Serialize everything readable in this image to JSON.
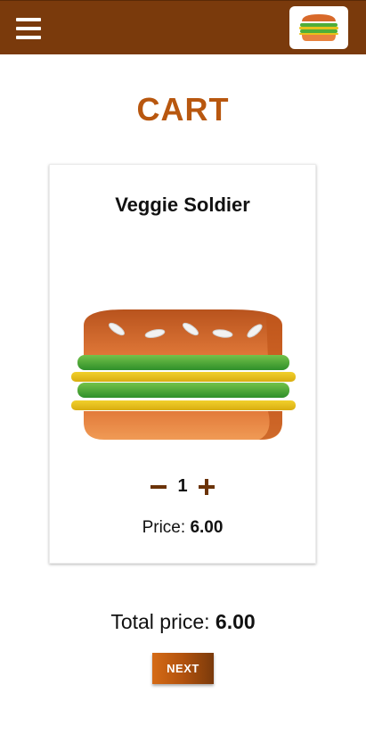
{
  "header": {
    "menu_icon": "hamburger-menu-icon",
    "logo_icon": "burger-logo-icon",
    "color": "#7a3a0c"
  },
  "page": {
    "title": "CART",
    "title_color": "#b8570f"
  },
  "cart_items": [
    {
      "name": "Veggie Soldier",
      "image_icon": "veggie-burger-icon",
      "quantity": "1",
      "price_label": "Price:",
      "price_value": "6.00"
    }
  ],
  "summary": {
    "total_label": "Total price:",
    "total_value": "6.00"
  },
  "actions": {
    "next_label": "NEXT"
  }
}
